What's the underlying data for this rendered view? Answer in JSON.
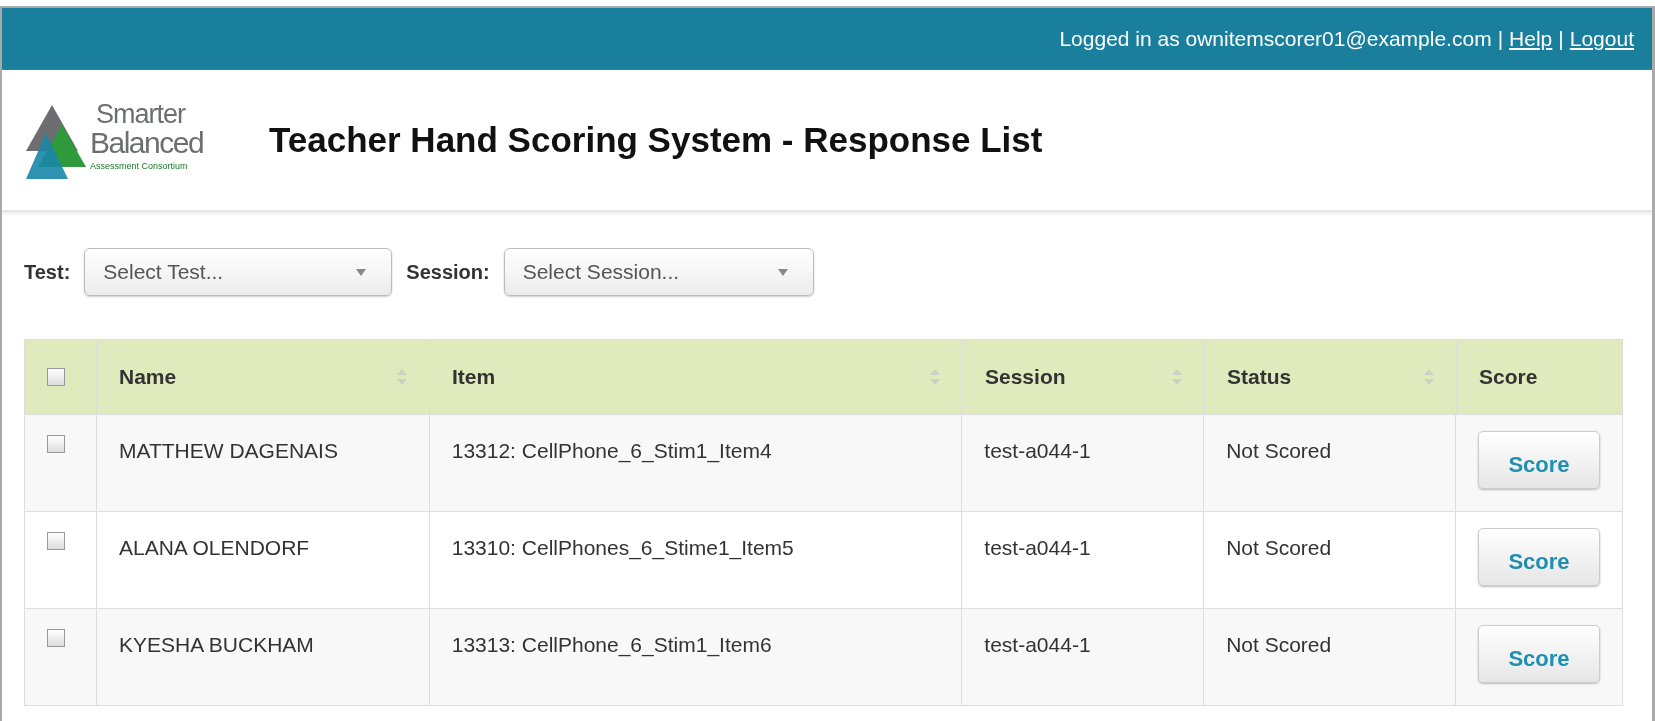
{
  "top_bar": {
    "login_text": "Logged in as ownitemscorer01@example.com",
    "separator_1": "|",
    "help_link": "Help",
    "separator_2": "|",
    "logout_link": "Logout"
  },
  "header": {
    "logo": {
      "line_1": "Smarter",
      "line_2": "Balanced",
      "tagline": "Assessment Consortium"
    },
    "title": "Teacher Hand Scoring System - Response List"
  },
  "filters": [
    {
      "label": "Test:",
      "placeholder": "Select Test..."
    },
    {
      "label": "Session:",
      "placeholder": "Select Session..."
    }
  ],
  "table": {
    "select_all_checked": false,
    "columns": [
      {
        "label": "Name",
        "sortable": true
      },
      {
        "label": "Item",
        "sortable": true
      },
      {
        "label": "Session",
        "sortable": true
      },
      {
        "label": "Status",
        "sortable": true
      },
      {
        "label": "Score",
        "sortable": false
      }
    ],
    "rows": [
      {
        "checked": false,
        "name": "MATTHEW DAGENAIS",
        "item": "13312: CellPhone_6_Stim1_Item4",
        "session": "test-a044-1",
        "status": "Not Scored",
        "action": "Score"
      },
      {
        "checked": false,
        "name": "ALANA OLENDORF",
        "item": "13310: CellPhones_6_Stime1_Item5",
        "session": "test-a044-1",
        "status": "Not Scored",
        "action": "Score"
      },
      {
        "checked": false,
        "name": "KYESHA BUCKHAM",
        "item": "13313: CellPhone_6_Stim1_Item6",
        "session": "test-a044-1",
        "status": "Not Scored",
        "action": "Score"
      }
    ]
  }
}
